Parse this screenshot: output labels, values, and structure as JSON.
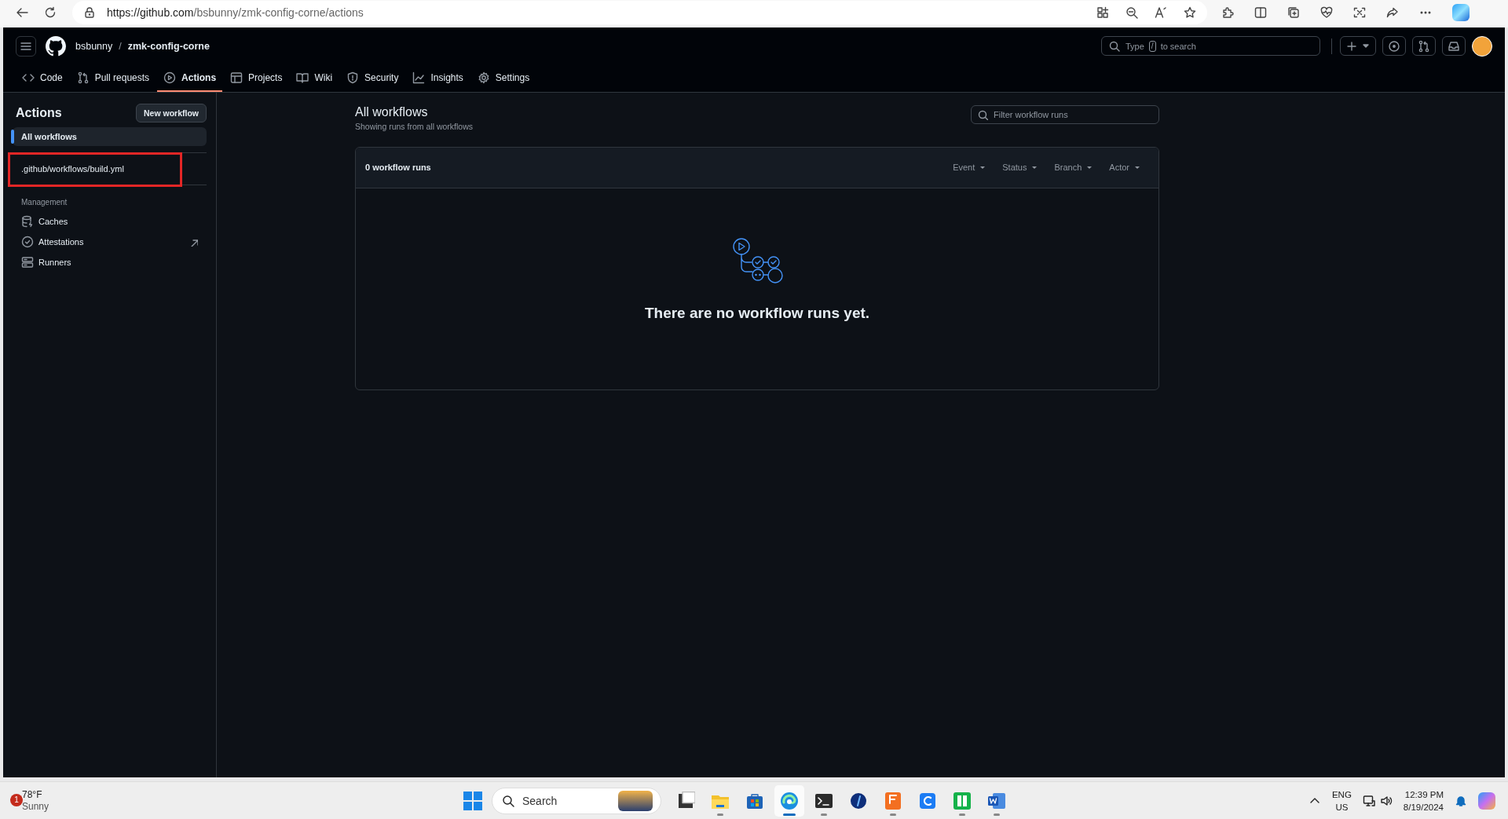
{
  "browser": {
    "url_host": "https://github.com",
    "url_path": "/bsbunny/zmk-config-corne/actions"
  },
  "header": {
    "owner": "bsbunny",
    "separator": "/",
    "repo": "zmk-config-corne",
    "search": {
      "before": "Type",
      "key": "/",
      "after": "to search"
    }
  },
  "repo_tabs": [
    {
      "label": "Code",
      "selected": false
    },
    {
      "label": "Pull requests",
      "selected": false
    },
    {
      "label": "Actions",
      "selected": true
    },
    {
      "label": "Projects",
      "selected": false
    },
    {
      "label": "Wiki",
      "selected": false
    },
    {
      "label": "Security",
      "selected": false
    },
    {
      "label": "Insights",
      "selected": false
    },
    {
      "label": "Settings",
      "selected": false
    }
  ],
  "sidebar": {
    "title": "Actions",
    "new_button": "New workflow",
    "workflows": [
      {
        "label": "All workflows",
        "selected": true,
        "highlighted": false
      },
      {
        "label": ".github/workflows/build.yml",
        "selected": false,
        "highlighted": true
      }
    ],
    "section": "Management",
    "management": [
      {
        "label": "Caches",
        "external": false
      },
      {
        "label": "Attestations",
        "external": true
      },
      {
        "label": "Runners",
        "external": false
      }
    ]
  },
  "main": {
    "title": "All workflows",
    "subtitle": "Showing runs from all workflows",
    "filter": {
      "placeholder": "Filter workflow runs"
    },
    "runs_count": "0 workflow runs",
    "filters": [
      "Event",
      "Status",
      "Branch",
      "Actor"
    ],
    "empty_message": "There are no workflow runs yet."
  },
  "taskbar": {
    "weather": {
      "badge": "1",
      "temp": "78°F",
      "condition": "Sunny"
    },
    "search": {
      "placeholder": "Search"
    },
    "apps": [
      {
        "active": false,
        "running": false
      },
      {
        "active": false,
        "running": true
      },
      {
        "active": false,
        "running": false
      },
      {
        "active": true,
        "running": true
      },
      {
        "active": false,
        "running": true
      },
      {
        "active": false,
        "running": false
      },
      {
        "active": false,
        "running": true
      },
      {
        "active": false,
        "running": false
      },
      {
        "active": false,
        "running": true
      },
      {
        "active": false,
        "running": true
      }
    ],
    "language": "ENG",
    "region": "US",
    "time": "12:39 PM",
    "date": "8/19/2024"
  }
}
